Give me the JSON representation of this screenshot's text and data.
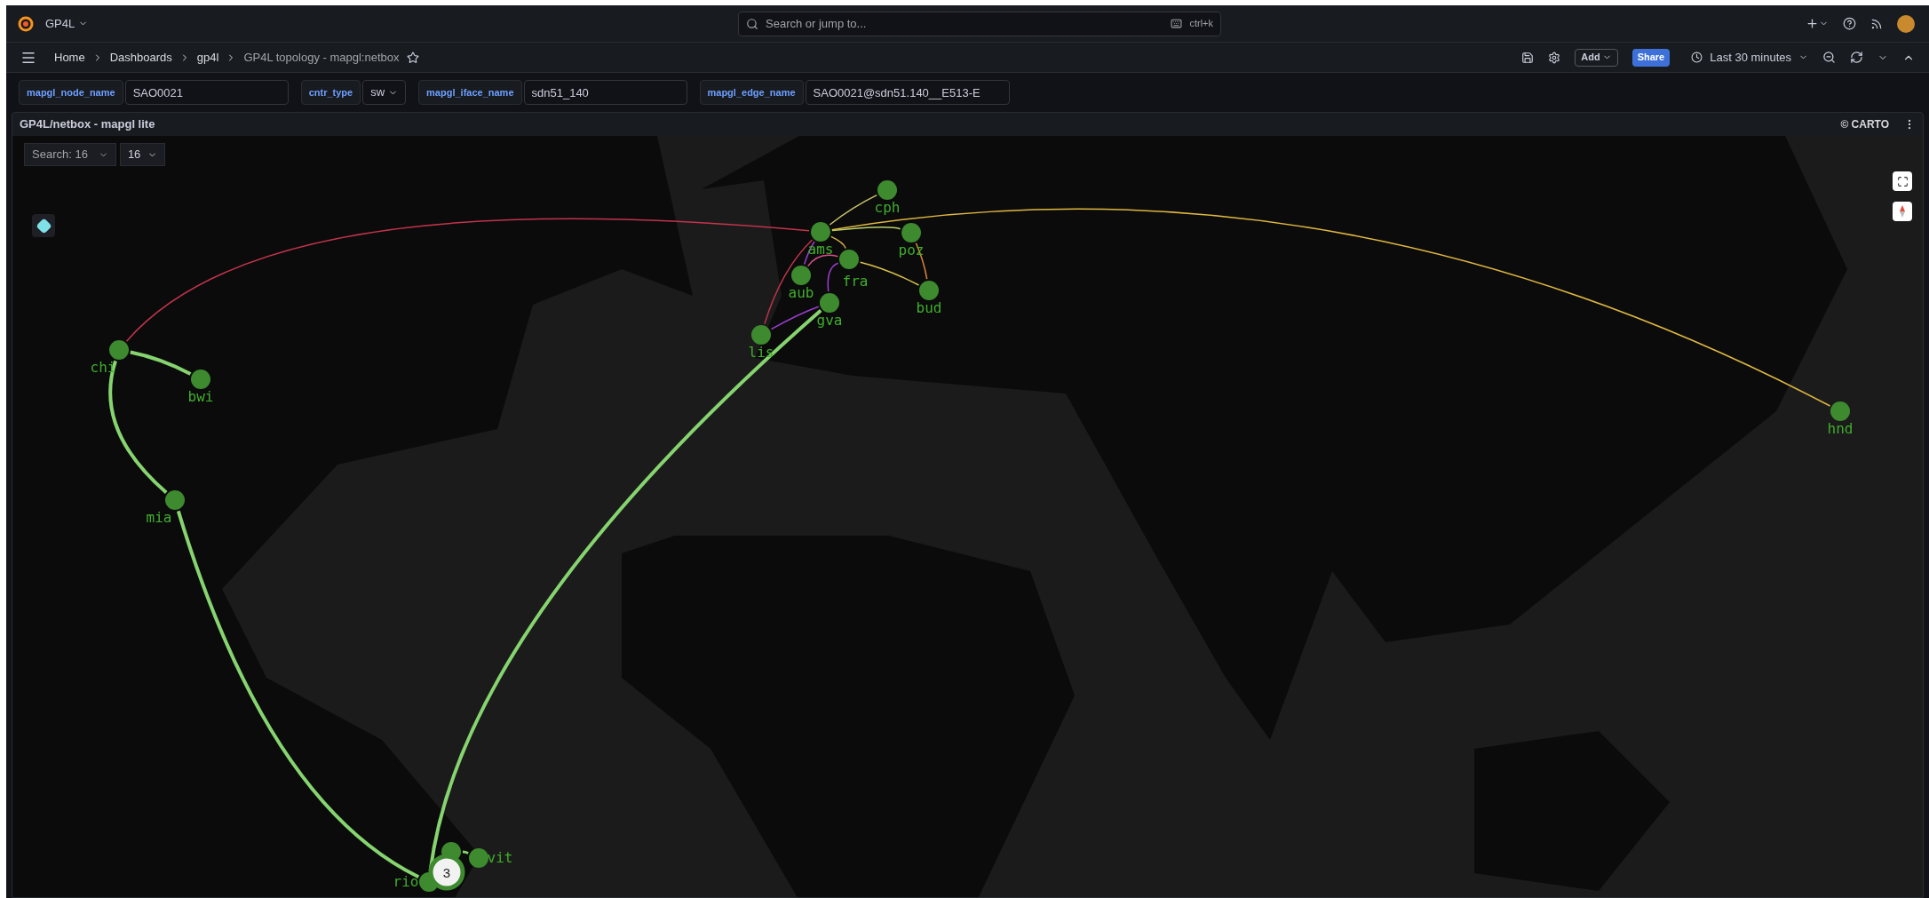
{
  "topbar": {
    "org": "GP4L",
    "search": {
      "placeholder": "Search or jump to..."
    },
    "shortcut": "ctrl+k"
  },
  "breadcrumbs": [
    {
      "label": "Home"
    },
    {
      "label": "Dashboards"
    },
    {
      "label": "gp4l"
    },
    {
      "label": "GP4L topology - mapgl:netbox"
    }
  ],
  "toolbar": {
    "add": "Add",
    "share": "Share",
    "time_range": "Last 30 minutes"
  },
  "variables": [
    {
      "label": "mapgl_node_name",
      "value": "SAO0021",
      "kind": "text"
    },
    {
      "label": "cntr_type",
      "value": "sw",
      "kind": "select"
    },
    {
      "label": "mapgl_iface_name",
      "value": "sdn51_140",
      "kind": "text"
    },
    {
      "label": "mapgl_edge_name",
      "value": "SAO0021@sdn51.140__E513-E",
      "kind": "text"
    }
  ],
  "panel": {
    "title": "GP4L/netbox - mapgl lite",
    "attribution": "© CARTO",
    "search_select": "Search: 16",
    "zoom_select": "16",
    "nodes": [
      {
        "label": "chi"
      },
      {
        "label": "bwi"
      },
      {
        "label": "mia"
      },
      {
        "label": "lis"
      },
      {
        "label": "ams"
      },
      {
        "label": "aub"
      },
      {
        "label": "fra"
      },
      {
        "label": "gva"
      },
      {
        "label": "cph"
      },
      {
        "label": "poz"
      },
      {
        "label": "bud"
      },
      {
        "label": "hnd"
      },
      {
        "label": "vit"
      },
      {
        "label": "rio"
      }
    ],
    "cluster": "3"
  }
}
